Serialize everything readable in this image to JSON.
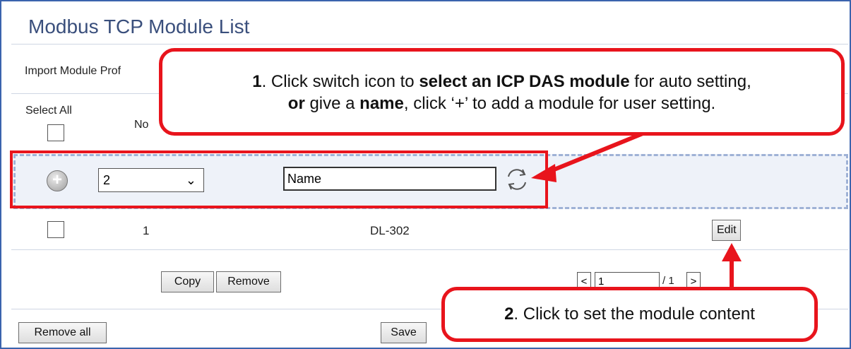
{
  "page_title": "Modbus TCP Module List",
  "toolbar": {
    "import_label": "Import Module Prof"
  },
  "header": {
    "select_all_label": "Select All",
    "no_label": "No"
  },
  "add_row": {
    "selected_value": "2",
    "name_value": "Name"
  },
  "module_rows": [
    {
      "no": "1",
      "name": "DL-302",
      "edit_label": "Edit"
    }
  ],
  "actions": {
    "copy_label": "Copy",
    "remove_label": "Remove",
    "remove_all_label": "Remove all",
    "save_label": "Save"
  },
  "pagination": {
    "prev_label": "<",
    "page_value": "1",
    "total": "/ 1",
    "next_label": ">"
  },
  "callout1": {
    "line1_num": "1",
    "line1_pre": ". Click switch icon to ",
    "line1_bold": "select an ICP DAS module",
    "line1_post": " for auto setting,",
    "line2_b1": "or",
    "line2_mid": " give a ",
    "line2_b2": "name",
    "line2_post": ", click ‘+’ to add a module for user setting."
  },
  "callout2": {
    "num": "2",
    "text": ". Click to set the module content"
  },
  "colors": {
    "accent": "#3a63ad",
    "highlight": "#e8141c"
  },
  "icons": [
    "plus-icon",
    "switch-icon",
    "chevron-down-icon"
  ]
}
